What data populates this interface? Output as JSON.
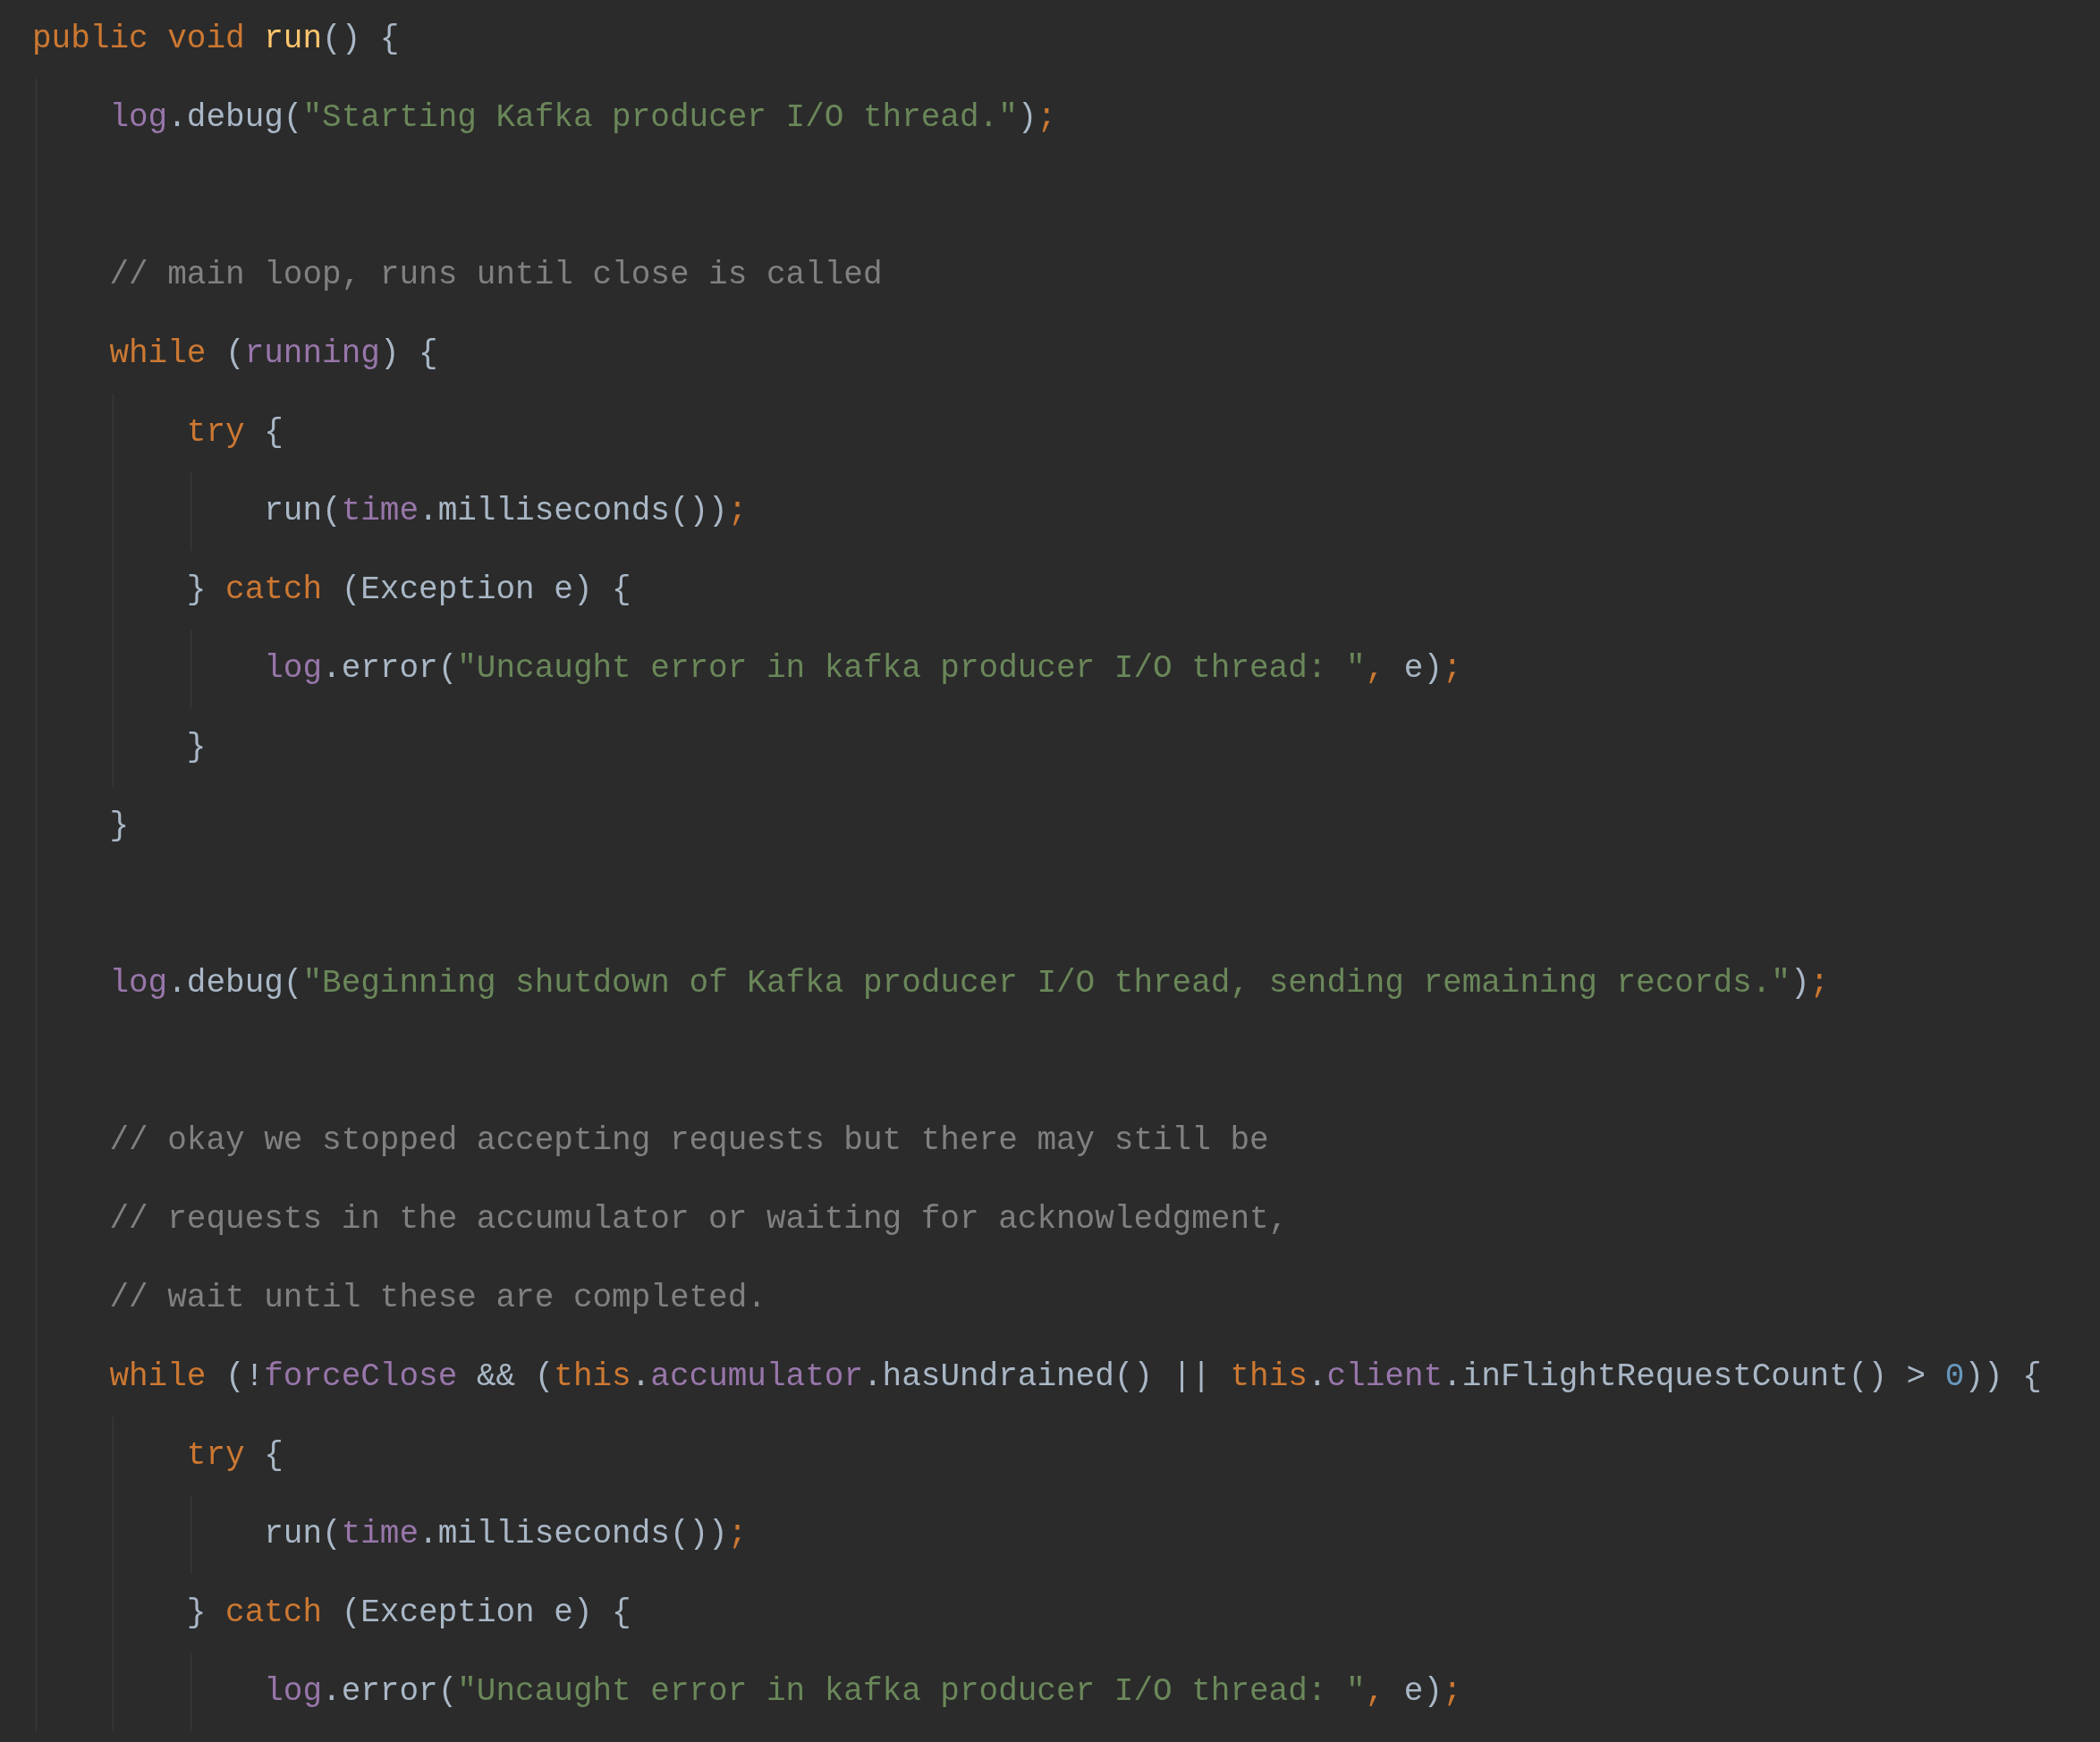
{
  "editor": {
    "lines": [
      {
        "kind": "code",
        "tokens": [
          {
            "kind": "keyword",
            "text": "public void "
          },
          {
            "kind": "declaration",
            "text": "run"
          },
          {
            "kind": "plain",
            "text": "() {"
          }
        ],
        "children": [
          {
            "kind": "code",
            "tokens": [
              {
                "kind": "field",
                "text": "log"
              },
              {
                "kind": "plain",
                "text": ".debug("
              },
              {
                "kind": "string",
                "text": "\"Starting Kafka producer I/O thread.\""
              },
              {
                "kind": "plain",
                "text": ")"
              },
              {
                "kind": "semicolon",
                "text": ";"
              }
            ]
          },
          {
            "kind": "blank"
          },
          {
            "kind": "code",
            "tokens": [
              {
                "kind": "comment",
                "text": "// main loop, runs until close is called"
              }
            ]
          },
          {
            "kind": "code",
            "tokens": [
              {
                "kind": "keyword",
                "text": "while "
              },
              {
                "kind": "plain",
                "text": "("
              },
              {
                "kind": "field",
                "text": "running"
              },
              {
                "kind": "plain",
                "text": ") {"
              }
            ],
            "children": [
              {
                "kind": "code",
                "tokens": [
                  {
                    "kind": "keyword",
                    "text": "try "
                  },
                  {
                    "kind": "plain",
                    "text": "{"
                  }
                ],
                "children": [
                  {
                    "kind": "code",
                    "tokens": [
                      {
                        "kind": "plain",
                        "text": "run("
                      },
                      {
                        "kind": "field",
                        "text": "time"
                      },
                      {
                        "kind": "plain",
                        "text": ".milliseconds())"
                      },
                      {
                        "kind": "semicolon",
                        "text": ";"
                      }
                    ]
                  }
                ]
              },
              {
                "kind": "code",
                "tokens": [
                  {
                    "kind": "plain",
                    "text": "} "
                  },
                  {
                    "kind": "keyword",
                    "text": "catch "
                  },
                  {
                    "kind": "plain",
                    "text": "(Exception e) {"
                  }
                ],
                "children": [
                  {
                    "kind": "code",
                    "tokens": [
                      {
                        "kind": "field",
                        "text": "log"
                      },
                      {
                        "kind": "plain",
                        "text": ".error("
                      },
                      {
                        "kind": "string",
                        "text": "\"Uncaught error in kafka producer I/O thread: \""
                      },
                      {
                        "kind": "semicolon",
                        "text": ", "
                      },
                      {
                        "kind": "plain",
                        "text": "e)"
                      },
                      {
                        "kind": "semicolon",
                        "text": ";"
                      }
                    ]
                  }
                ]
              },
              {
                "kind": "code",
                "tokens": [
                  {
                    "kind": "plain",
                    "text": "}"
                  }
                ]
              }
            ]
          },
          {
            "kind": "code",
            "tokens": [
              {
                "kind": "plain",
                "text": "}"
              }
            ]
          },
          {
            "kind": "blank"
          },
          {
            "kind": "code",
            "tokens": [
              {
                "kind": "field",
                "text": "log"
              },
              {
                "kind": "plain",
                "text": ".debug("
              },
              {
                "kind": "string",
                "text": "\"Beginning shutdown of Kafka producer I/O thread, sending remaining records.\""
              },
              {
                "kind": "plain",
                "text": ")"
              },
              {
                "kind": "semicolon",
                "text": ";"
              }
            ]
          },
          {
            "kind": "blank"
          },
          {
            "kind": "code",
            "tokens": [
              {
                "kind": "comment",
                "text": "// okay we stopped accepting requests but there may still be"
              }
            ]
          },
          {
            "kind": "code",
            "tokens": [
              {
                "kind": "comment",
                "text": "// requests in the accumulator or waiting for acknowledgment,"
              }
            ]
          },
          {
            "kind": "code",
            "tokens": [
              {
                "kind": "comment",
                "text": "// wait until these are completed."
              }
            ]
          },
          {
            "kind": "code",
            "tokens": [
              {
                "kind": "keyword",
                "text": "while "
              },
              {
                "kind": "plain",
                "text": "(!"
              },
              {
                "kind": "field",
                "text": "forceClose "
              },
              {
                "kind": "plain",
                "text": "&& ("
              },
              {
                "kind": "keyword",
                "text": "this"
              },
              {
                "kind": "plain",
                "text": "."
              },
              {
                "kind": "field",
                "text": "accumulator"
              },
              {
                "kind": "plain",
                "text": ".hasUndrained() || "
              },
              {
                "kind": "keyword",
                "text": "this"
              },
              {
                "kind": "plain",
                "text": "."
              },
              {
                "kind": "field",
                "text": "client"
              },
              {
                "kind": "plain",
                "text": ".inFlightRequestCount() > "
              },
              {
                "kind": "number",
                "text": "0"
              },
              {
                "kind": "plain",
                "text": ")) {"
              }
            ],
            "children": [
              {
                "kind": "code",
                "tokens": [
                  {
                    "kind": "keyword",
                    "text": "try "
                  },
                  {
                    "kind": "plain",
                    "text": "{"
                  }
                ],
                "children": [
                  {
                    "kind": "code",
                    "tokens": [
                      {
                        "kind": "plain",
                        "text": "run("
                      },
                      {
                        "kind": "field",
                        "text": "time"
                      },
                      {
                        "kind": "plain",
                        "text": ".milliseconds())"
                      },
                      {
                        "kind": "semicolon",
                        "text": ";"
                      }
                    ]
                  }
                ]
              },
              {
                "kind": "code",
                "tokens": [
                  {
                    "kind": "plain",
                    "text": "} "
                  },
                  {
                    "kind": "keyword",
                    "text": "catch "
                  },
                  {
                    "kind": "plain",
                    "text": "(Exception e) {"
                  }
                ],
                "children": [
                  {
                    "kind": "code",
                    "tokens": [
                      {
                        "kind": "field",
                        "text": "log"
                      },
                      {
                        "kind": "plain",
                        "text": ".error("
                      },
                      {
                        "kind": "string",
                        "text": "\"Uncaught error in kafka producer I/O thread: \""
                      },
                      {
                        "kind": "semicolon",
                        "text": ", "
                      },
                      {
                        "kind": "plain",
                        "text": "e)"
                      },
                      {
                        "kind": "semicolon",
                        "text": ";"
                      }
                    ]
                  }
                ]
              }
            ]
          }
        ]
      }
    ]
  }
}
